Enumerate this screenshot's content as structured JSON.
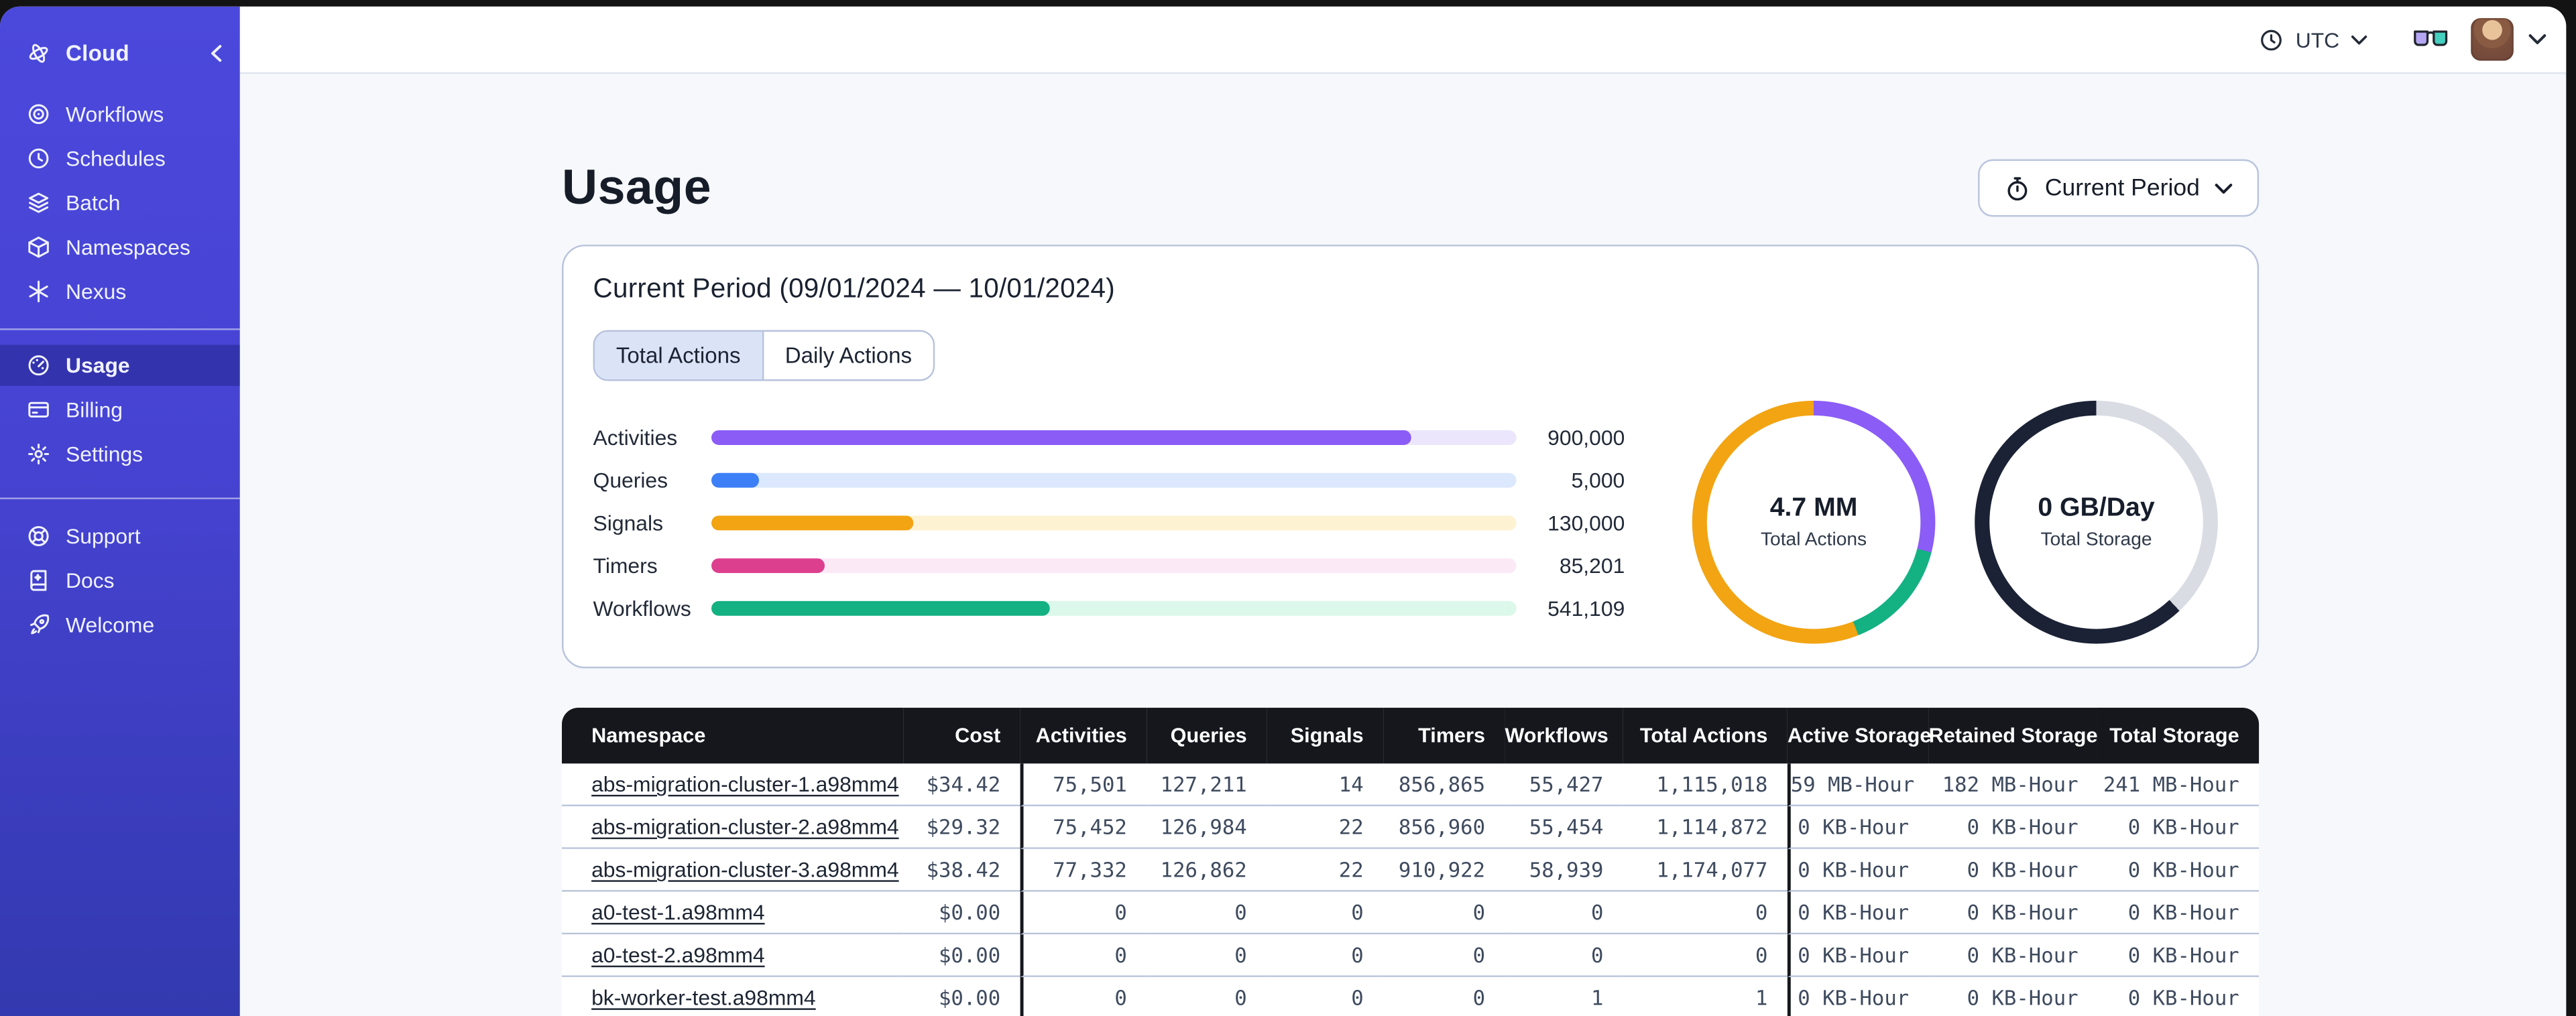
{
  "topbar": {
    "timezone_label": "UTC"
  },
  "sidebar": {
    "brand": {
      "label": "Cloud",
      "icon": "cloud-orbit-icon"
    },
    "nav_main": [
      {
        "label": "Workflows",
        "icon": "workflows-icon"
      },
      {
        "label": "Schedules",
        "icon": "schedules-icon"
      },
      {
        "label": "Batch",
        "icon": "batch-icon"
      },
      {
        "label": "Namespaces",
        "icon": "namespaces-icon"
      },
      {
        "label": "Nexus",
        "icon": "nexus-icon"
      }
    ],
    "nav_account": [
      {
        "label": "Usage",
        "icon": "usage-icon",
        "selected": true
      },
      {
        "label": "Billing",
        "icon": "billing-icon"
      },
      {
        "label": "Settings",
        "icon": "settings-icon"
      }
    ],
    "nav_help": [
      {
        "label": "Support",
        "icon": "support-icon"
      },
      {
        "label": "Docs",
        "icon": "docs-icon"
      },
      {
        "label": "Welcome",
        "icon": "welcome-icon"
      }
    ]
  },
  "page": {
    "title": "Usage",
    "period_button": {
      "label": "Current Period",
      "icon": "stopwatch-icon"
    }
  },
  "usage_card": {
    "title": "Current Period (09/01/2024 — 10/01/2024)",
    "tabs": [
      {
        "label": "Total Actions",
        "selected": true
      },
      {
        "label": "Daily Actions",
        "selected": false
      }
    ]
  },
  "chart_data": [
    {
      "type": "bar",
      "orientation": "horizontal",
      "categories": [
        "Activities",
        "Queries",
        "Signals",
        "Timers",
        "Workflows"
      ],
      "values": [
        900000,
        5000,
        130000,
        85201,
        541109
      ],
      "value_labels": [
        "900,000",
        "5,000",
        "130,000",
        "85,201",
        "541,109"
      ],
      "fill_pct": [
        87,
        6,
        25,
        14,
        42
      ],
      "colors": [
        "#8b5cf6",
        "#3d7ff7",
        "#f2a413",
        "#dd3f8f",
        "#14b183"
      ],
      "track_colors": [
        "#ece6fc",
        "#dce8fd",
        "#fdf2d2",
        "#fce9f6",
        "#dcf8ea"
      ],
      "grid": false,
      "legend": "none"
    },
    {
      "type": "pie",
      "style": "donut",
      "name": "total-actions-donut",
      "center_value": "4.7 MM",
      "center_label": "Total Actions",
      "segments": [
        {
          "label": "activities",
          "color": "#8b5cf6",
          "pct": 29
        },
        {
          "label": "workflows",
          "color": "#14b183",
          "pct": 15
        },
        {
          "label": "signals",
          "color": "#f2a413",
          "pct": 56
        }
      ]
    },
    {
      "type": "pie",
      "style": "donut",
      "name": "total-storage-donut",
      "center_value": "0 GB/Day",
      "center_label": "Total Storage",
      "segments": [
        {
          "label": "remaining",
          "color": "#d9dce3",
          "pct": 38
        },
        {
          "label": "used",
          "color": "#1b2235",
          "pct": 62
        }
      ]
    }
  ],
  "table": {
    "columns": [
      "Namespace",
      "Cost",
      "Activities",
      "Queries",
      "Signals",
      "Timers",
      "Workflows",
      "Total Actions",
      "Active Storage",
      "Retained Storage",
      "Total Storage"
    ],
    "rows": [
      [
        "abs-migration-cluster-1.a98mm4",
        "$34.42",
        "75,501",
        "127,211",
        "14",
        "856,865",
        "55,427",
        "1,115,018",
        "59 MB-Hour",
        "182 MB-Hour",
        "241 MB-Hour"
      ],
      [
        "abs-migration-cluster-2.a98mm4",
        "$29.32",
        "75,452",
        "126,984",
        "22",
        "856,960",
        "55,454",
        "1,114,872",
        "0 KB-Hour",
        "0 KB-Hour",
        "0 KB-Hour"
      ],
      [
        "abs-migration-cluster-3.a98mm4",
        "$38.42",
        "77,332",
        "126,862",
        "22",
        "910,922",
        "58,939",
        "1,174,077",
        "0 KB-Hour",
        "0 KB-Hour",
        "0 KB-Hour"
      ],
      [
        "a0-test-1.a98mm4",
        "$0.00",
        "0",
        "0",
        "0",
        "0",
        "0",
        "0",
        "0 KB-Hour",
        "0 KB-Hour",
        "0 KB-Hour"
      ],
      [
        "a0-test-2.a98mm4",
        "$0.00",
        "0",
        "0",
        "0",
        "0",
        "0",
        "0",
        "0 KB-Hour",
        "0 KB-Hour",
        "0 KB-Hour"
      ],
      [
        "bk-worker-test.a98mm4",
        "$0.00",
        "0",
        "0",
        "0",
        "0",
        "1",
        "1",
        "0 KB-Hour",
        "0 KB-Hour",
        "0 KB-Hour"
      ]
    ]
  },
  "colors": {
    "sidebar_top": "#4b48dc",
    "sidebar_bottom": "#3339af",
    "accent_purple": "#8b5cf6",
    "accent_blue": "#3d7ff7",
    "accent_orange": "#f2a413",
    "accent_pink": "#dd3f8f",
    "accent_green": "#14b183",
    "table_header_bg": "#15171d",
    "card_border": "#b9c3dc",
    "page_bg": "#f6f8fb"
  }
}
